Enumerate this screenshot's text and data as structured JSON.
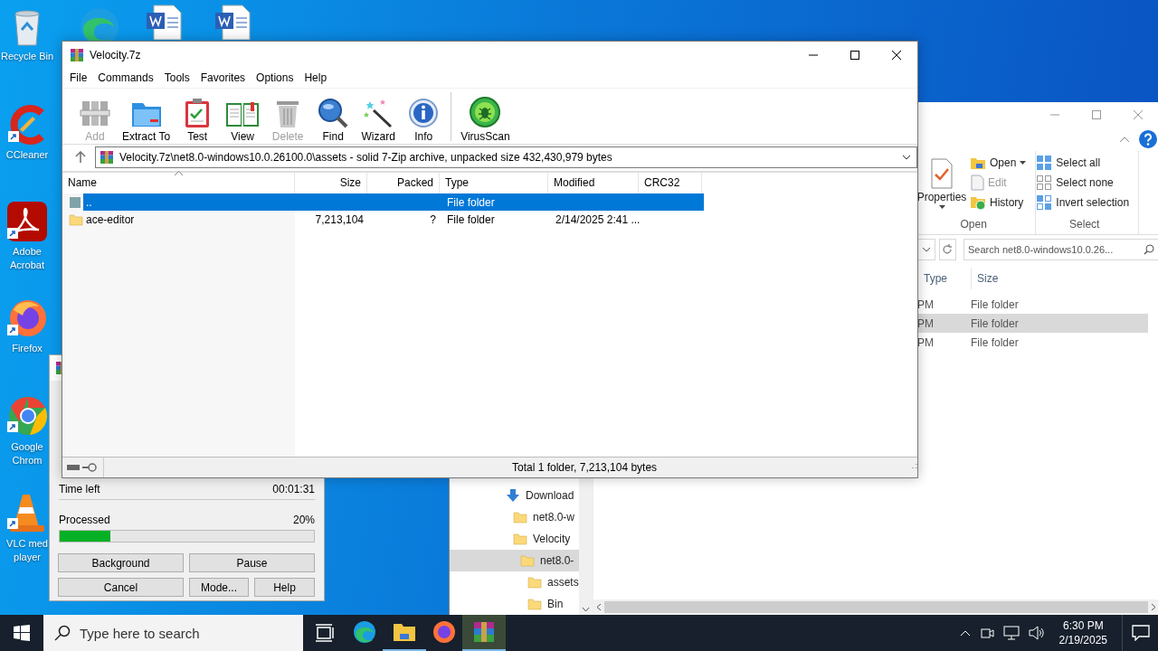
{
  "desktop": {
    "icons": [
      {
        "label": "Recycle Bin"
      },
      {
        "label": "CCleaner"
      },
      {
        "label": "Adobe Acrobat"
      },
      {
        "label": "Firefox"
      },
      {
        "label": "Google Chrom"
      },
      {
        "label": "VLC med player"
      }
    ]
  },
  "explorer": {
    "ribbon_groups": [
      {
        "label": "Open",
        "items": [
          {
            "label": "Properties",
            "kind": "large",
            "disabled": false
          },
          {
            "label": "Open",
            "kind": "dropdown",
            "disabled": false
          },
          {
            "label": "Edit",
            "kind": "small",
            "disabled": true
          },
          {
            "label": "History",
            "kind": "small",
            "disabled": false
          }
        ]
      },
      {
        "label": "Select",
        "items": [
          {
            "label": "Select all",
            "kind": "small",
            "disabled": false
          },
          {
            "label": "Select none",
            "kind": "small",
            "disabled": false
          },
          {
            "label": "Invert selection",
            "kind": "small",
            "disabled": false
          }
        ]
      }
    ],
    "search": {
      "placeholder": "Search net8.0-windows10.0.26..."
    },
    "columns": [
      "Type",
      "Size"
    ],
    "rows": [
      {
        "modified": "PM",
        "type": "File folder",
        "selected": false
      },
      {
        "modified": "PM",
        "type": "File folder",
        "selected": true
      },
      {
        "modified": "PM",
        "type": "File folder",
        "selected": false
      }
    ],
    "tree": [
      {
        "label": "Download",
        "kind": "downloads",
        "selected": false,
        "children": [
          {
            "label": "net8.0-w",
            "kind": "folder",
            "selected": false
          },
          {
            "label": "Velocity",
            "kind": "folder",
            "selected": false,
            "children": [
              {
                "label": "net8.0-",
                "kind": "folder",
                "selected": true,
                "children": [
                  {
                    "label": "assets",
                    "kind": "folder",
                    "selected": false
                  },
                  {
                    "label": "Bin",
                    "kind": "folder",
                    "selected": false
                  }
                ]
              }
            ]
          }
        ]
      }
    ]
  },
  "progress": {
    "time_left_label": "Time left",
    "time_left": "00:01:31",
    "processed_label": "Processed",
    "percent": "20%",
    "level": 0.2,
    "buttons": [
      "Background",
      "Pause",
      "Cancel",
      "Mode...",
      "Help"
    ]
  },
  "archive": {
    "title": "Velocity.7z",
    "menu": [
      "File",
      "Commands",
      "Tools",
      "Favorites",
      "Options",
      "Help"
    ],
    "toolbar": [
      {
        "label": "Add",
        "disabled": true
      },
      {
        "label": "Extract To",
        "disabled": false
      },
      {
        "label": "Test",
        "disabled": false
      },
      {
        "label": "View",
        "disabled": false
      },
      {
        "label": "Delete",
        "disabled": true
      },
      {
        "label": "Find",
        "disabled": false
      },
      {
        "label": "Wizard",
        "disabled": false
      },
      {
        "label": "Info",
        "disabled": false
      },
      {
        "label": "VirusScan",
        "disabled": false
      }
    ],
    "path": "Velocity.7z\\net8.0-windows10.0.26100.0\\assets - solid 7-Zip archive, unpacked size 432,430,979 bytes",
    "columns": [
      {
        "label": "Name",
        "sorted": true
      },
      {
        "label": "Size",
        "sorted": false
      },
      {
        "label": "Packed",
        "sorted": false
      },
      {
        "label": "Type",
        "sorted": false
      },
      {
        "label": "Modified",
        "sorted": false
      },
      {
        "label": "CRC32",
        "sorted": false
      }
    ],
    "rows": [
      {
        "name": "..",
        "kind": "parent",
        "type": "File folder",
        "selected": true
      },
      {
        "name": "ace-editor",
        "kind": "folder",
        "size": "7,213,104",
        "packed": "?",
        "type": "File folder",
        "modified": "2/14/2025 2:41 ...",
        "selected": false
      }
    ],
    "status": "Total 1 folder, 7,213,104 bytes"
  },
  "taskbar": {
    "search_placeholder": "Type here to search",
    "apps": [
      {
        "running": false,
        "selected": false
      },
      {
        "running": true,
        "selected": false
      },
      {
        "running": false,
        "selected": false
      },
      {
        "running": true,
        "selected": true
      }
    ],
    "clock": {
      "time": "6:30 PM",
      "date": "2/19/2025"
    }
  }
}
